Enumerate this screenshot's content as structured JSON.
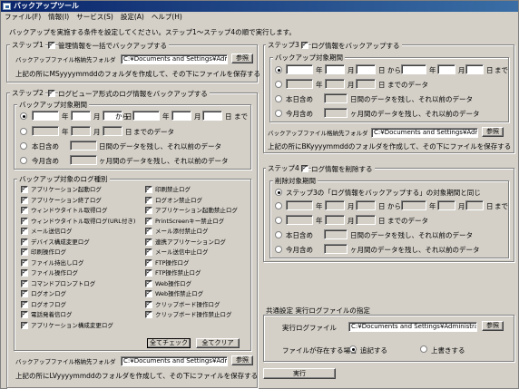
{
  "window": {
    "title": "バックアップツール"
  },
  "menu": [
    "ファイル(F)",
    "情報(I)",
    "サービス(S)",
    "設定(A)",
    "ヘルプ(H)"
  ],
  "intro": "バックアップを実施する条件を設定してください。ステップ1～ステップ4の順で実行します。",
  "step1": {
    "title": "ステップ1",
    "check_label": "管理情報を一括でバックアップする",
    "folder_label": "バックアップファイル格納先フォルダ",
    "folder_value": "C:¥Documents and Settings¥Administrator¥My",
    "browse": "参照",
    "note": "上記の所にMSyyyymmddのフォルダを作成して、その下にファイルを保存する"
  },
  "step2": {
    "title": "ステップ2",
    "check_label": "ログビューア形式のログ情報をバックアップする",
    "period": {
      "title": "バックアップ対象期間",
      "y": "年",
      "m": "月",
      "d": "日",
      "from": "から",
      "to": "まで",
      "until": "までのデータ",
      "today_label": "本日含め",
      "days_suffix": "日間のデータを残し、それ以前のデータ",
      "month_label": "今月含め",
      "months_suffix": "ヶ月間のデータを残し、それ以前のデータ"
    },
    "types": {
      "title": "バックアップ対象のログ種別",
      "left": [
        "アプリケーション起動ログ",
        "アプリケーション終了ログ",
        "ウィンドウタイトル取得ログ",
        "ウィンドウタイトル取得ログ(URL付き)",
        "メール送信ログ",
        "デバイス構成変更ログ",
        "印刷操作ログ",
        "ファイル持出しログ",
        "ファイル操作ログ",
        "コマンドプロンプトログ",
        "ログオンログ",
        "ログオフログ",
        "電話発着信ログ",
        "アプリケーション構成変更ログ"
      ],
      "right": [
        "印刷禁止ログ",
        "ログオン禁止ログ",
        "アプリケーション起動禁止ログ",
        "PrintScreenキー禁止ログ",
        "メール添付禁止ログ",
        "連携アプリケーションログ",
        "メール送信中止ログ",
        "FTP操作ログ",
        "FTP操作禁止ログ",
        "Web操作ログ",
        "Web操作禁止ログ",
        "クリップボード操作ログ",
        "クリップボード操作禁止ログ"
      ],
      "check_all": "全てチェック",
      "clear_all": "全てクリア"
    },
    "folder_label": "バックアップファイル格納先フォルダ",
    "folder_value": "C:¥Documents and Settings¥Administrator¥My",
    "browse": "参照",
    "note": "上記の所にLVyyyymmddのフォルダを作成して、その下にファイルを保存する"
  },
  "step3": {
    "title": "ステップ3",
    "check_label": "ログ情報をバックアップする",
    "period": {
      "title": "バックアップ対象期間",
      "y": "年",
      "m": "月",
      "d": "日",
      "from": "から",
      "to": "まで",
      "until": "までのデータ",
      "today_label": "本日含め",
      "days_suffix": "日間のデータを残し、それ以前のデータ",
      "month_label": "今月含め",
      "months_suffix": "ヶ月間のデータを残し、それ以前のデータ"
    },
    "folder_label": "バックアップファイル格納先フォルダ",
    "folder_value": "C:¥Documents and Settings¥Administrator¥My",
    "browse": "参照",
    "note": "上記の所にBKyyyymmddのフォルダを作成して、その下にファイルを保存する"
  },
  "step4": {
    "title": "ステップ4",
    "check_label": "ログ情報を削除する",
    "period": {
      "title": "削除対象期間",
      "same_label": "ステップ3の「ログ情報をバックアップする」の対象期間と同じ",
      "y": "年",
      "m": "月",
      "d": "日",
      "from": "から",
      "to": "まで",
      "until": "までのデータ",
      "today_label": "本日含め",
      "days_suffix": "日間のデータを残し、それ以前のデータ",
      "month_label": "今月含め",
      "months_suffix": "ヶ月間のデータを残し、それ以前のデータ"
    }
  },
  "common": {
    "title": "共通設定 実行ログファイルの指定",
    "log_label": "実行ログファイル",
    "log_value": "C:¥Documents and Settings¥Administrator¥My",
    "browse": "参照",
    "exists_label": "ファイルが存在する場合",
    "append": "追記する",
    "overwrite": "上書きする"
  },
  "run": "実行"
}
